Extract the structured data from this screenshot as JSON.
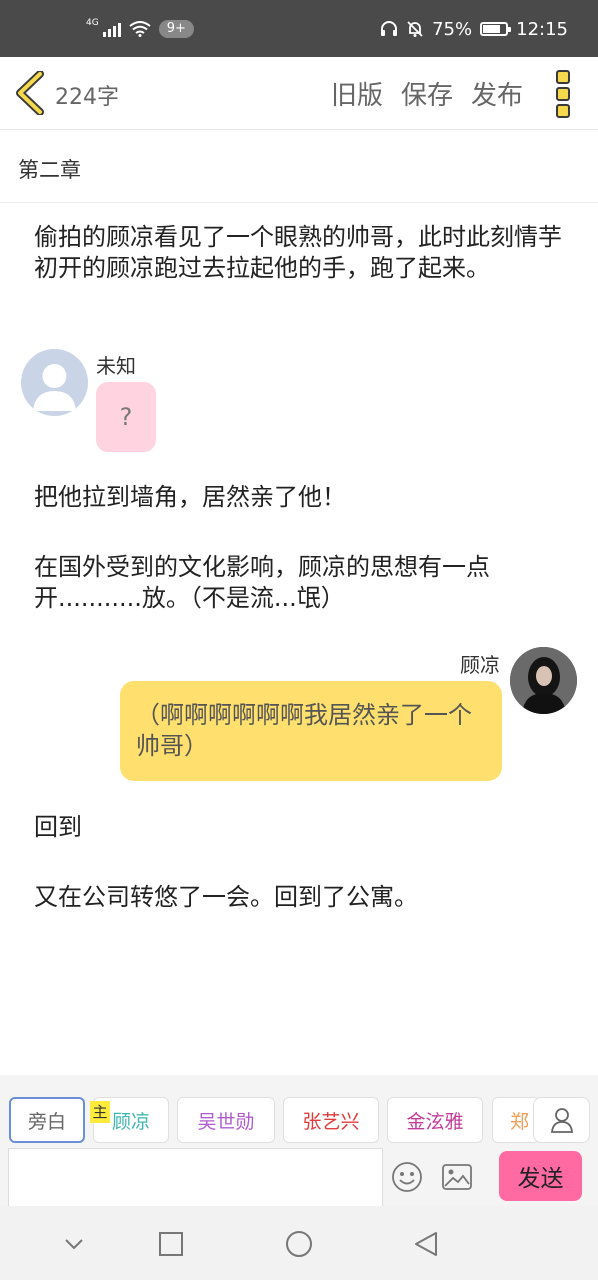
{
  "status_bar": {
    "network": "4G",
    "notification_badge": "9+",
    "battery": "75%",
    "battery_level": 0.75,
    "time": "12:15"
  },
  "header": {
    "word_count": "224字",
    "old_version": "旧版",
    "save": "保存",
    "publish": "发布"
  },
  "chapter": {
    "title": "第二章"
  },
  "story": {
    "para1": "偷拍的顾凉看见了一个眼熟的帅哥，此时此刻情芋初开的顾凉跑过去拉起他的手，跑了起来。",
    "msg1": {
      "speaker": "未知",
      "text": "?"
    },
    "para2": "把他拉到墙角，居然亲了他！",
    "para3": "在国外受到的文化影响，顾凉的思想有一点开...........放。（不是流...氓）",
    "msg2": {
      "speaker": "顾凉",
      "text": "（啊啊啊啊啊啊我居然亲了一个帅哥）"
    },
    "para4": "回到",
    "para5": "又在公司转悠了一会。回到了公寓。"
  },
  "role_bar": {
    "main_tag": "主",
    "roles": [
      {
        "label": "旁白",
        "color": "#666666"
      },
      {
        "label": "顾凉",
        "color": "#3fb7b0"
      },
      {
        "label": "吴世勋",
        "color": "#b05ccf"
      },
      {
        "label": "张艺兴",
        "color": "#e03c3c"
      },
      {
        "label": "金泫雅",
        "color": "#c43c9a"
      },
      {
        "label": "郑",
        "color": "#f0a05a"
      }
    ],
    "send_label": "发送"
  },
  "icons": {
    "back": "back-chevron-icon",
    "more": "more-vertical-icon",
    "add_role": "person-icon",
    "emoji": "emoji-icon",
    "image": "image-icon",
    "nav_back": "triangle-back-icon",
    "nav_home": "circle-home-icon",
    "nav_recent": "square-recent-icon",
    "nav_down": "chevron-down-icon"
  },
  "colors": {
    "accent_yellow": "#f6d84c",
    "send_pink": "#ff6aa2",
    "left_bubble": "#ffd3df",
    "right_bubble": "#ffdf6e"
  }
}
